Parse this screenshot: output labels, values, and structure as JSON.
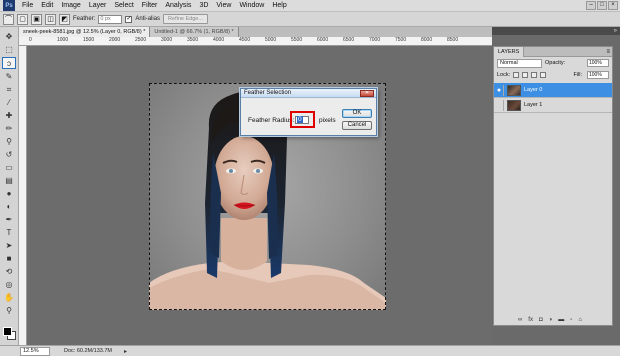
{
  "menubar": {
    "logo": "Ps",
    "items": [
      "File",
      "Edit",
      "Image",
      "Layer",
      "Select",
      "Filter",
      "Analysis",
      "3D",
      "View",
      "Window",
      "Help"
    ]
  },
  "options_bar": {
    "feather_label": "Feather:",
    "feather_value": "0 px",
    "antialias_label": "Anti-alias",
    "refine_edge_label": "Refine Edge..."
  },
  "tabs": [
    {
      "label": "sneek-peek-8581.jpg @ 12.5% (Layer 0, RGB/8) *",
      "active": true
    },
    {
      "label": "Untitled-1 @ 66.7% (1, RGB/8) *",
      "active": false
    }
  ],
  "rulers": {
    "top": [
      "0",
      "1000",
      "1500",
      "2000",
      "2500",
      "3000",
      "3500",
      "4000",
      "4500",
      "5000",
      "5500",
      "6000",
      "6500",
      "7000",
      "7500",
      "8000",
      "8500"
    ]
  },
  "status": {
    "zoom": "12.5%",
    "doc_info": "Doc: 60.2M/133.7M"
  },
  "layers_panel": {
    "tab": "LAYERS",
    "blend_mode": "Normal",
    "opacity_label": "Opacity:",
    "opacity_value": "100%",
    "lock_label": "Lock:",
    "fill_label": "Fill:",
    "fill_value": "100%",
    "layers": [
      {
        "name": "Layer 0",
        "selected": true
      },
      {
        "name": "Layer 1",
        "selected": false
      }
    ],
    "footer_icons": [
      "link-icon",
      "fx-icon",
      "mask-icon",
      "adjustment-icon",
      "group-icon",
      "new-layer-icon",
      "trash-icon"
    ]
  },
  "dialog": {
    "title": "Feather Selection",
    "radius_label": "Feather Radius:",
    "radius_value": "0",
    "unit": "pixels",
    "ok_label": "OK",
    "cancel_label": "Cancel"
  },
  "colors": {
    "accent": "#3d8fe3",
    "highlight_box": "#e00000"
  }
}
